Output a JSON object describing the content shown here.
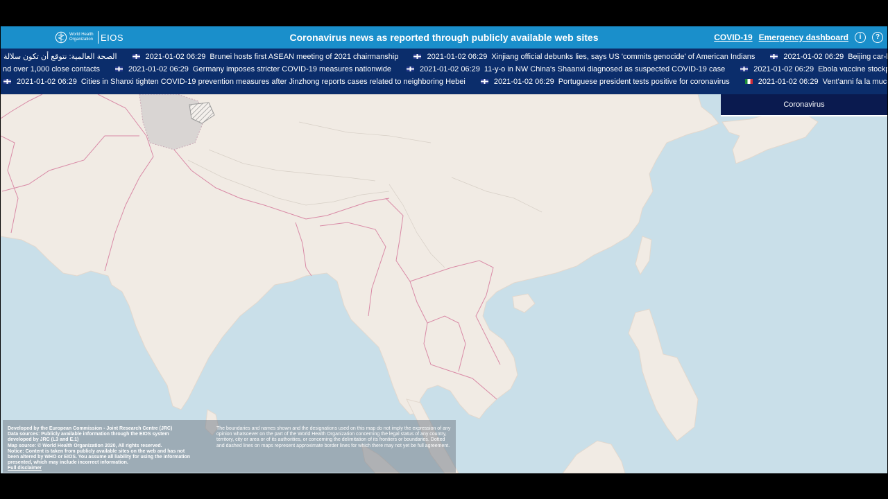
{
  "header": {
    "logo_who": "World Health Organization",
    "logo_eios": "EIOS",
    "title": "Coronavirus news as reported through publicly available web sites",
    "link_covid": "COVID-19",
    "link_dashboard": "Emergency dashboard",
    "info_icon": "i",
    "help_icon": "?"
  },
  "ticker": {
    "row1": [
      {
        "flag": "",
        "ts": "",
        "text": "الصحة العالمية: نتوقع أن تكون سلالة"
      },
      {
        "flag": "uk",
        "ts": "2021-01-02 06:29",
        "text": "Brunei hosts first ASEAN meeting of 2021 chairmanship"
      },
      {
        "flag": "uk",
        "ts": "2021-01-02 06:29",
        "text": "Xinjiang official debunks lies, says US 'commits genocide' of American Indians"
      },
      {
        "flag": "uk",
        "ts": "2021-01-02 06:29",
        "text": "Beijing car-hailing platfor"
      }
    ],
    "row2": [
      {
        "flag": "",
        "ts": "",
        "text": "nd over 1,000 close contacts"
      },
      {
        "flag": "uk",
        "ts": "2021-01-02 06:29",
        "text": "Germany imposes stricter COVID-19 measures nationwide"
      },
      {
        "flag": "uk",
        "ts": "2021-01-02 06:29",
        "text": "11-y-o in NW China's Shaanxi diagnosed as suspected COVID-19 case"
      },
      {
        "flag": "uk",
        "ts": "2021-01-02 06:29",
        "text": "Ebola vaccine stockpile set"
      }
    ],
    "row3": [
      {
        "flag": "uk",
        "ts": "2021-01-02 06:29",
        "text": "Cities in Shanxi tighten COVID-19 prevention measures after Jinzhong reports cases related to neighboring Hebei"
      },
      {
        "flag": "uk",
        "ts": "2021-01-02 06:29",
        "text": "Portuguese president tests positive for coronavirus"
      },
      {
        "flag": "it",
        "ts": "2021-01-02 06:29",
        "text": "Vent'anni fa la mucca pazza"
      }
    ]
  },
  "panel": {
    "tab_label": "Coronavirus"
  },
  "disclaimer": {
    "left": [
      "Developed by the European Commission - Joint Research Centre (JRC)",
      "Data sources: Publicly available information through the EIOS system",
      "developed by JRC (L3 and E.1)",
      "Map source: © World Health Organization 2020, All rights reserved.",
      "Notice: Content is taken from publicly available sites on the web and has not",
      "been altered by WHO or EIOS. You assume all liability for using the information",
      "presented, which may include incorrect information."
    ],
    "left_link": "Full disclaimer",
    "right": "The boundaries and names shown and the designations used on this map do not imply the expression of any opinion whatsoever on the part of the World Health Organization concerning the legal status of any country, territory, city or area or of its authorities, or concerning the delimitation of its frontiers or boundaries. Dotted and dashed lines on maps represent approximate border lines for which there may not yet be full agreement."
  },
  "colors": {
    "header_bg": "#1a8fcb",
    "ticker_bg": "#0b2d6b",
    "panel_bg": "#0a1a4f",
    "land": "#f1ebe4",
    "sea": "#c9dfe9",
    "border": "#d98aa6"
  }
}
